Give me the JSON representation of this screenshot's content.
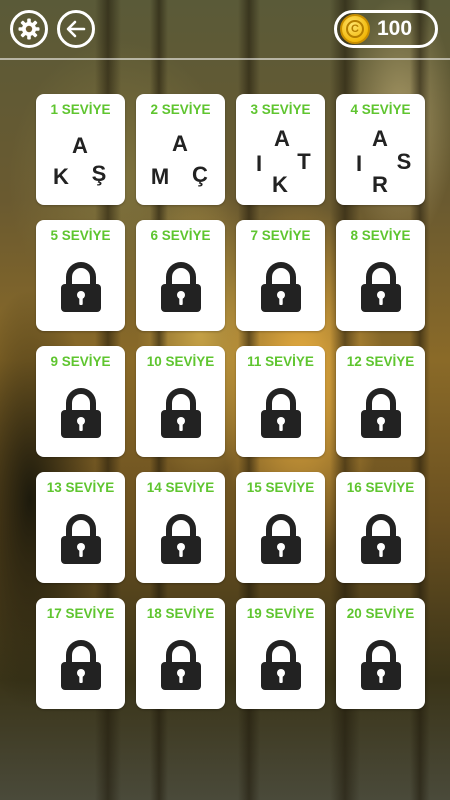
{
  "header": {
    "settings_icon": "gear-icon",
    "back_icon": "arrow-left-icon",
    "coin_symbol": "C",
    "coin_count": "100"
  },
  "levels": [
    {
      "label": "1 SEVİYE",
      "locked": false,
      "letters": [
        "A",
        "K",
        "Ş"
      ]
    },
    {
      "label": "2 SEVİYE",
      "locked": false,
      "letters": [
        "A",
        "M",
        "Ç"
      ]
    },
    {
      "label": "3 SEVİYE",
      "locked": false,
      "letters": [
        "A",
        "I",
        "T",
        "K"
      ]
    },
    {
      "label": "4 SEVİYE",
      "locked": false,
      "letters": [
        "A",
        "I",
        "S",
        "R"
      ]
    },
    {
      "label": "5 SEVİYE",
      "locked": true
    },
    {
      "label": "6 SEVİYE",
      "locked": true
    },
    {
      "label": "7 SEVİYE",
      "locked": true
    },
    {
      "label": "8 SEVİYE",
      "locked": true
    },
    {
      "label": "9 SEVİYE",
      "locked": true
    },
    {
      "label": "10 SEVİYE",
      "locked": true
    },
    {
      "label": "11 SEVİYE",
      "locked": true
    },
    {
      "label": "12 SEVİYE",
      "locked": true
    },
    {
      "label": "13 SEVİYE",
      "locked": true
    },
    {
      "label": "14 SEVİYE",
      "locked": true
    },
    {
      "label": "15 SEVİYE",
      "locked": true
    },
    {
      "label": "16 SEVİYE",
      "locked": true
    },
    {
      "label": "17 SEVİYE",
      "locked": true
    },
    {
      "label": "18 SEVİYE",
      "locked": true
    },
    {
      "label": "19 SEVİYE",
      "locked": true
    },
    {
      "label": "20 SEVİYE",
      "locked": true
    }
  ],
  "colors": {
    "label_green": "#5fc52f",
    "letter_dark": "#222222",
    "lock_dark": "#222222",
    "coin_gold": "#f2b90c"
  }
}
